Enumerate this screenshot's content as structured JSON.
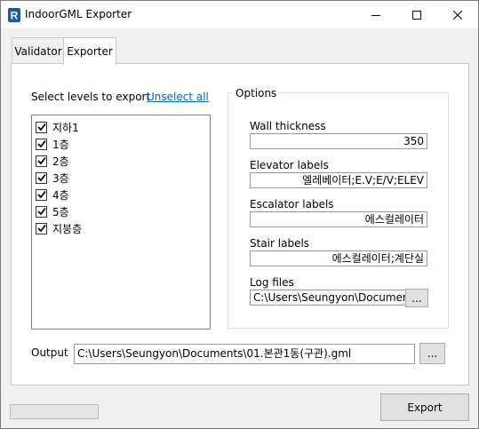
{
  "window": {
    "title": "IndoorGML Exporter"
  },
  "tabs": [
    {
      "label": "Validator"
    },
    {
      "label": "Exporter"
    }
  ],
  "levels": {
    "heading": "Select levels to export",
    "unselect_all": "Unselect all",
    "items": [
      {
        "label": "지하1",
        "checked": true
      },
      {
        "label": "1층",
        "checked": true
      },
      {
        "label": "2층",
        "checked": true
      },
      {
        "label": "3층",
        "checked": true
      },
      {
        "label": "4층",
        "checked": true
      },
      {
        "label": "5층",
        "checked": true
      },
      {
        "label": "지붕층",
        "checked": true
      }
    ]
  },
  "options": {
    "legend": "Options",
    "wall_thickness": {
      "label": "Wall thickness",
      "value": "350"
    },
    "elevator_labels": {
      "label": "Elevator labels",
      "value": "엘레베이터;E.V;E/V;ELEV"
    },
    "escalator_labels": {
      "label": "Escalator labels",
      "value": "에스컬레이터"
    },
    "stair_labels": {
      "label": "Stair labels",
      "value": "에스컬레이터;계단실"
    },
    "log_files": {
      "label": "Log files",
      "value": "C:\\Users\\Seungyon\\Documents\\",
      "browse_label": "..."
    }
  },
  "output": {
    "label": "Output",
    "value": "C:\\Users\\Seungyon\\Documents\\01.본관1동(구관).gml",
    "browse_label": "..."
  },
  "footer": {
    "export_label": "Export",
    "progress": 0
  },
  "colors": {
    "link": "#0066cc",
    "revit_icon": "#1d5aa6",
    "progress": "#06b025"
  }
}
